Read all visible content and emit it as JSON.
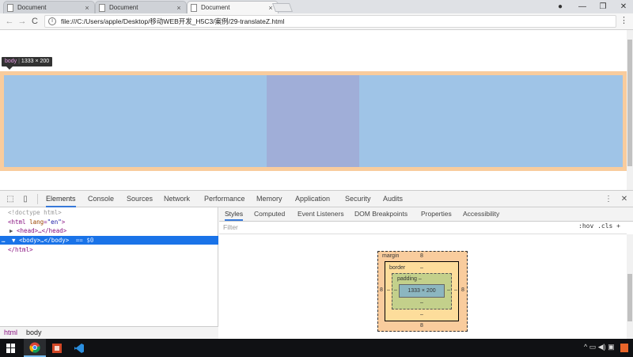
{
  "browser": {
    "tabs": [
      {
        "title": "Document",
        "active": false
      },
      {
        "title": "Document",
        "active": false
      },
      {
        "title": "Document",
        "active": true
      }
    ],
    "tab_close": "×",
    "window_controls": {
      "profile": "●",
      "minimize": "—",
      "restore": "❐",
      "close": "✕"
    },
    "nav": {
      "back": "←",
      "forward": "→",
      "reload": "C"
    },
    "address": {
      "info_icon": "i",
      "url": "file:///C:/Users/apple/Desktop/移动WEB开发_H5C3/案例/29-translateZ.html"
    },
    "menu": "⋮"
  },
  "page_overlay": {
    "tooltip_tag": "body",
    "tooltip_size": "1333 × 200",
    "colors": {
      "margin": "#f9cc9d",
      "content": "#9fc4e7",
      "translated_box": "#a0aed8"
    }
  },
  "devtools": {
    "toolbar_icons": [
      "inspect-icon",
      "device-icon"
    ],
    "tabs": [
      "Elements",
      "Console",
      "Sources",
      "Network",
      "Performance",
      "Memory",
      "Application",
      "Security",
      "Audits"
    ],
    "active_tab": "Elements",
    "more": "⋮",
    "close": "✕",
    "dom": {
      "doctype": "<!doctype html>",
      "html_open_tag": "<html",
      "html_attr": "lang",
      "html_val": "\"en\"",
      "html_open_end": ">",
      "head_line": "<head>…</head>",
      "body_line": "<body>…</body>",
      "body_eq": "== $0",
      "html_close": "</html>",
      "ellipsis": "…",
      "collapsed_arrow": "▶",
      "expanded_arrow": "▼"
    },
    "breadcrumbs": [
      "html",
      "body"
    ],
    "styles_tabs": [
      "Styles",
      "Computed",
      "Event Listeners",
      "DOM Breakpoints",
      "Properties",
      "Accessibility"
    ],
    "active_styles_tab": "Styles",
    "filter_placeholder": "Filter",
    "filter_buttons": ":hov  .cls  +",
    "box_model": {
      "margin_label": "margin",
      "margin_top": "8",
      "margin_bottom": "8",
      "margin_left": "8",
      "margin_right": "8",
      "border_label": "border",
      "border_top": "–",
      "border_bottom": "–",
      "border_left": "–",
      "border_right": "–",
      "padding_label": "padding –",
      "padding_bottom": "–",
      "padding_left": "–",
      "padding_right": "–",
      "content": "1333 × 200"
    }
  },
  "taskbar": {
    "apps": [
      "chrome-icon",
      "powerpoint-icon",
      "vscode-icon"
    ],
    "tray": "^  ▭  ◀)  ▣"
  }
}
